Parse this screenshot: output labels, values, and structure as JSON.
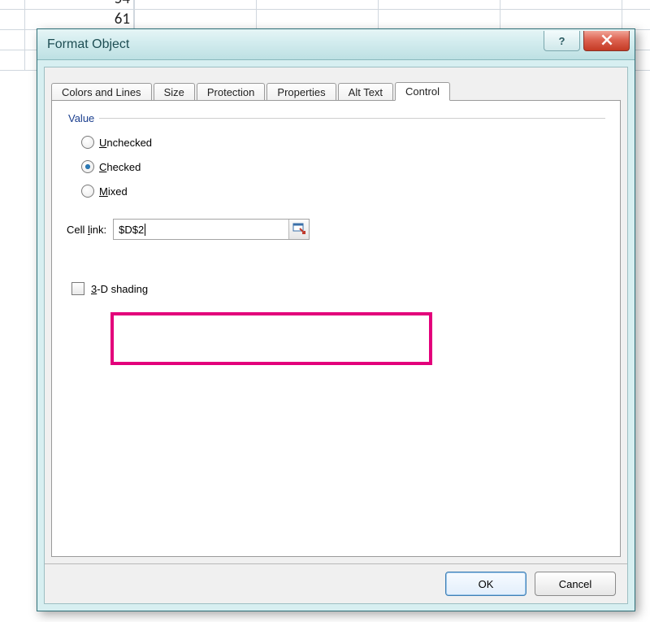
{
  "sheet": {
    "cells": [
      {
        "row": 0,
        "text": "54"
      },
      {
        "row": 1,
        "text": "61"
      }
    ]
  },
  "dialog": {
    "title": "Format Object",
    "tabs": [
      {
        "id": "tab-colors-lines",
        "label": "Colors and Lines"
      },
      {
        "id": "tab-size",
        "label": "Size"
      },
      {
        "id": "tab-protection",
        "label": "Protection"
      },
      {
        "id": "tab-properties",
        "label": "Properties"
      },
      {
        "id": "tab-alt-text",
        "label": "Alt Text"
      },
      {
        "id": "tab-control",
        "label": "Control",
        "active": true
      }
    ],
    "control_tab": {
      "group_label": "Value",
      "radios": {
        "unchecked_label_pre": "",
        "unchecked_mn": "U",
        "unchecked_rest": "nchecked",
        "checked_mn": "C",
        "checked_rest": "hecked",
        "mixed_mn": "M",
        "mixed_rest": "ixed",
        "selected": "checked"
      },
      "cell_link": {
        "label_pre": "Cell ",
        "label_mn": "l",
        "label_post": "ink:",
        "value": "$D$2"
      },
      "shading": {
        "mn": "3",
        "rest": "-D shading",
        "checked": false
      }
    },
    "buttons": {
      "ok": "OK",
      "cancel": "Cancel"
    }
  }
}
